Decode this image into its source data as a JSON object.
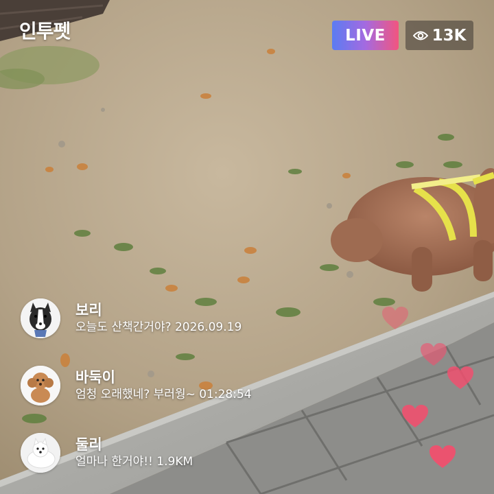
{
  "header": {
    "app_title": "인투펫",
    "live_label": "LIVE",
    "viewer_count": "13K",
    "viewer_icon": "eye-icon"
  },
  "comments": [
    {
      "user": "보리",
      "text": "오늘도 산책간거야? 2026.09.19",
      "avatar": "border-collie-avatar"
    },
    {
      "user": "바둑이",
      "text": "엄청 오래했네? 부러웡~ 01:28:54",
      "avatar": "poodle-avatar"
    },
    {
      "user": "둘리",
      "text": "얼마나 한거야!! 1.9KM",
      "avatar": "white-dog-avatar"
    }
  ],
  "reactions": {
    "icon": "heart-icon",
    "color": "#f0506e"
  },
  "colors": {
    "live_gradient_start": "#5b7cf2",
    "live_gradient_end": "#f2557f",
    "viewer_badge_bg": "#3c3732"
  }
}
